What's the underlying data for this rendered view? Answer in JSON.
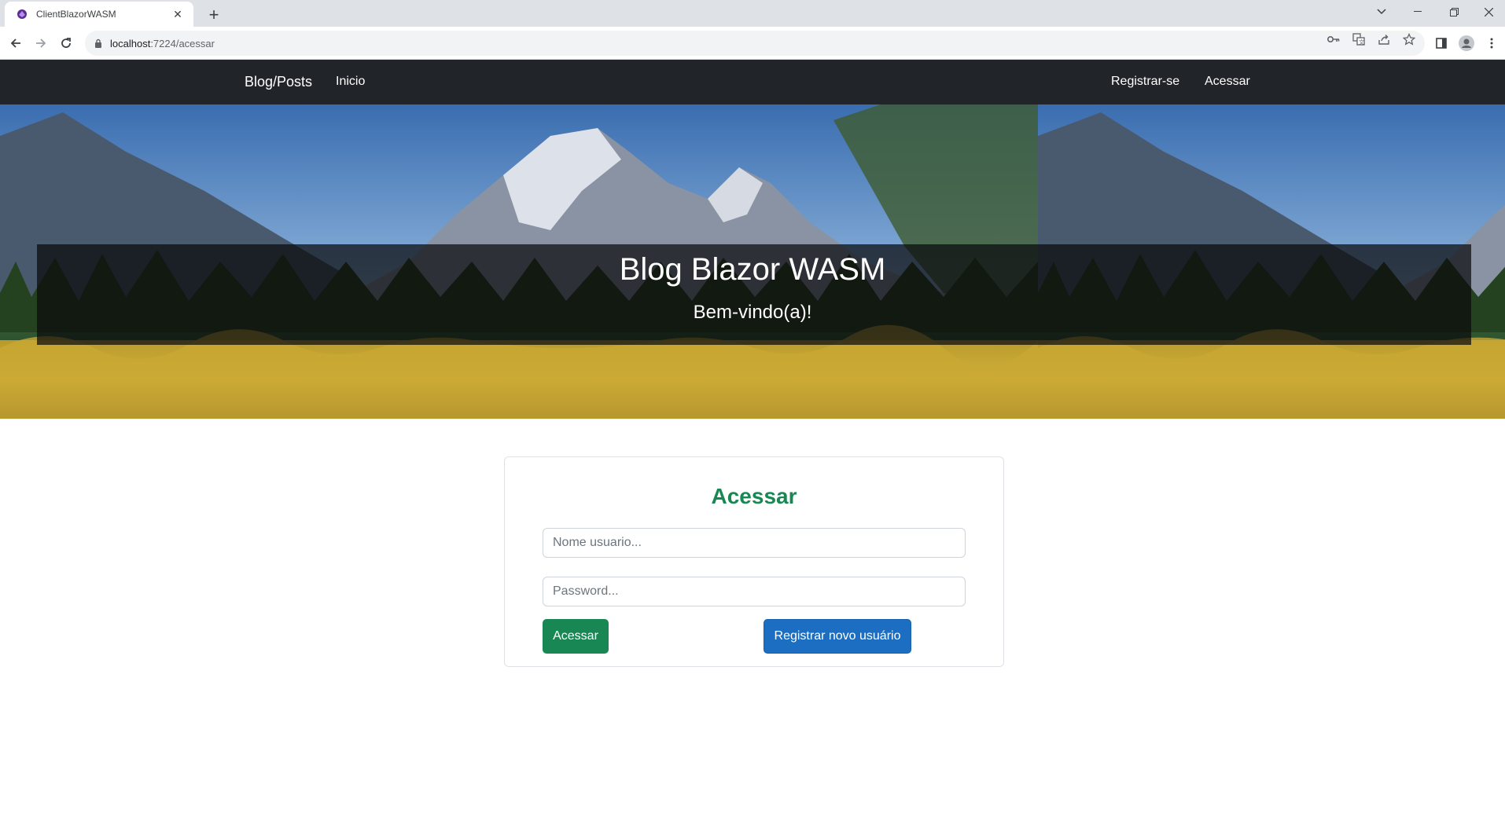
{
  "browser": {
    "tab_title": "ClientBlazorWASM",
    "url_host": "localhost",
    "url_path": ":7224/acessar"
  },
  "navbar": {
    "brand": "Blog/Posts",
    "left_links": [
      "Inicio"
    ],
    "right_links": [
      "Registrar-se",
      "Acessar"
    ]
  },
  "hero": {
    "title": "Blog Blazor WASM",
    "subtitle": "Bem-vindo(a)!"
  },
  "login": {
    "heading": "Acessar",
    "username_placeholder": "Nome usuario...",
    "password_placeholder": "Password...",
    "submit_label": "Acessar",
    "register_label": "Registrar novo usuário"
  },
  "colors": {
    "navbar_bg": "#212529",
    "success": "#198754",
    "primary": "#1b6ec2"
  }
}
